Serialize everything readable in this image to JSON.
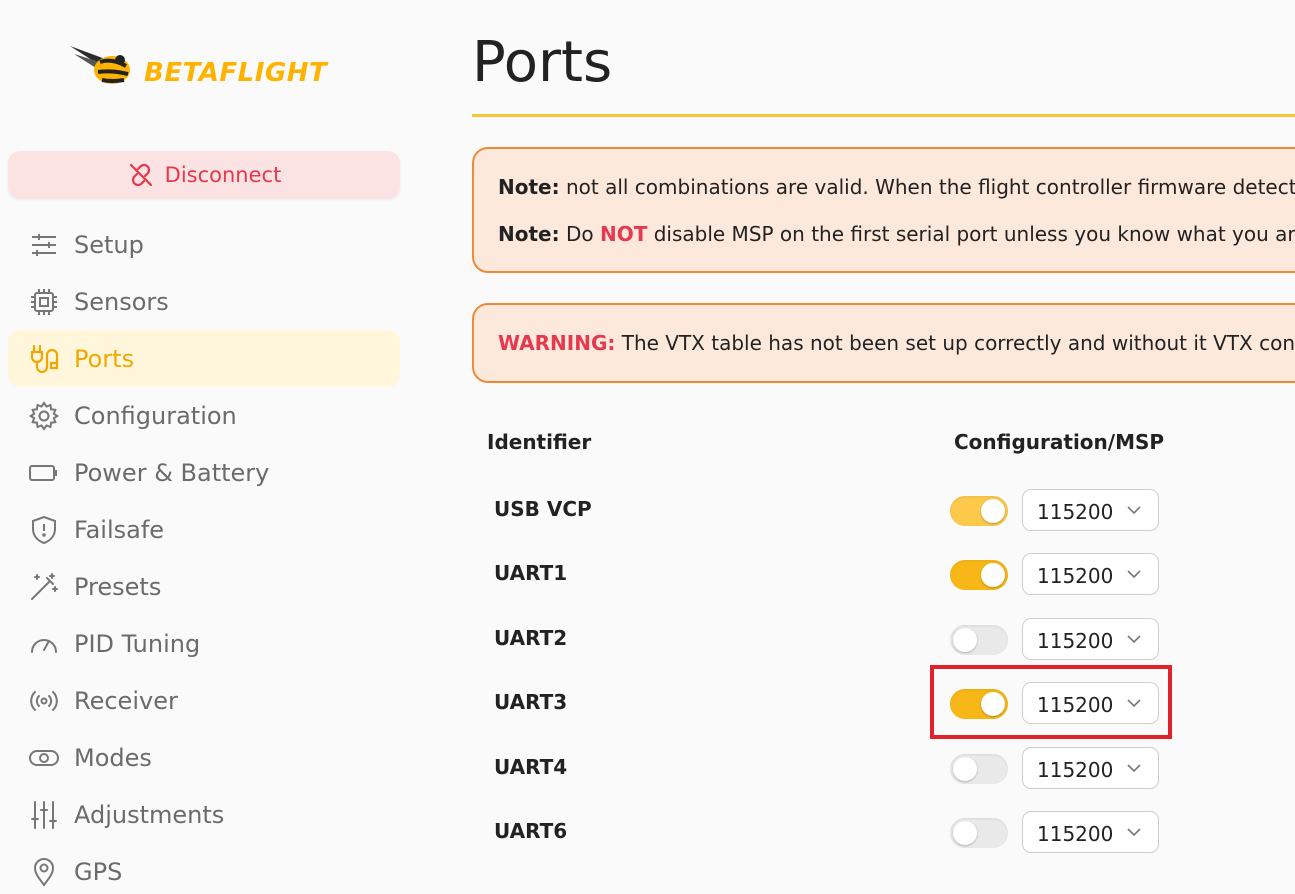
{
  "brand": {
    "name": "BETAFLIGHT",
    "accent": "#ffb300"
  },
  "sidebar": {
    "disconnect_label": "Disconnect",
    "items": [
      {
        "label": "Setup",
        "icon": "sliders-icon"
      },
      {
        "label": "Sensors",
        "icon": "chip-icon"
      },
      {
        "label": "Ports",
        "icon": "plug-icon",
        "active": true
      },
      {
        "label": "Configuration",
        "icon": "gear-icon"
      },
      {
        "label": "Power & Battery",
        "icon": "battery-icon"
      },
      {
        "label": "Failsafe",
        "icon": "shield-icon"
      },
      {
        "label": "Presets",
        "icon": "wand-icon"
      },
      {
        "label": "PID Tuning",
        "icon": "gauge-icon"
      },
      {
        "label": "Receiver",
        "icon": "broadcast-icon"
      },
      {
        "label": "Modes",
        "icon": "toggle-icon"
      },
      {
        "label": "Adjustments",
        "icon": "adjust-sliders-icon"
      },
      {
        "label": "GPS",
        "icon": "map-pin-icon"
      }
    ]
  },
  "main": {
    "title": "Ports",
    "note1": {
      "prefix": "Note:",
      "text": " not all combinations are valid. When the flight controller firmware detects"
    },
    "note2": {
      "prefix": "Note:",
      "text_before": " Do ",
      "emphasis": "NOT",
      "text_after": " disable MSP on the first serial port unless you know what you are"
    },
    "warning": {
      "prefix": "WARNING:",
      "text": " The VTX table has not been set up correctly and without it VTX contro"
    },
    "columns": {
      "identifier": "Identifier",
      "config_msp": "Configuration/MSP"
    },
    "ports": [
      {
        "id": "USB VCP",
        "msp_enabled": true,
        "baud": "115200"
      },
      {
        "id": "UART1",
        "msp_enabled": true,
        "baud": "115200"
      },
      {
        "id": "UART2",
        "msp_enabled": false,
        "baud": "115200"
      },
      {
        "id": "UART3",
        "msp_enabled": true,
        "baud": "115200"
      },
      {
        "id": "UART4",
        "msp_enabled": false,
        "baud": "115200"
      },
      {
        "id": "UART6",
        "msp_enabled": false,
        "baud": "115200"
      }
    ]
  }
}
